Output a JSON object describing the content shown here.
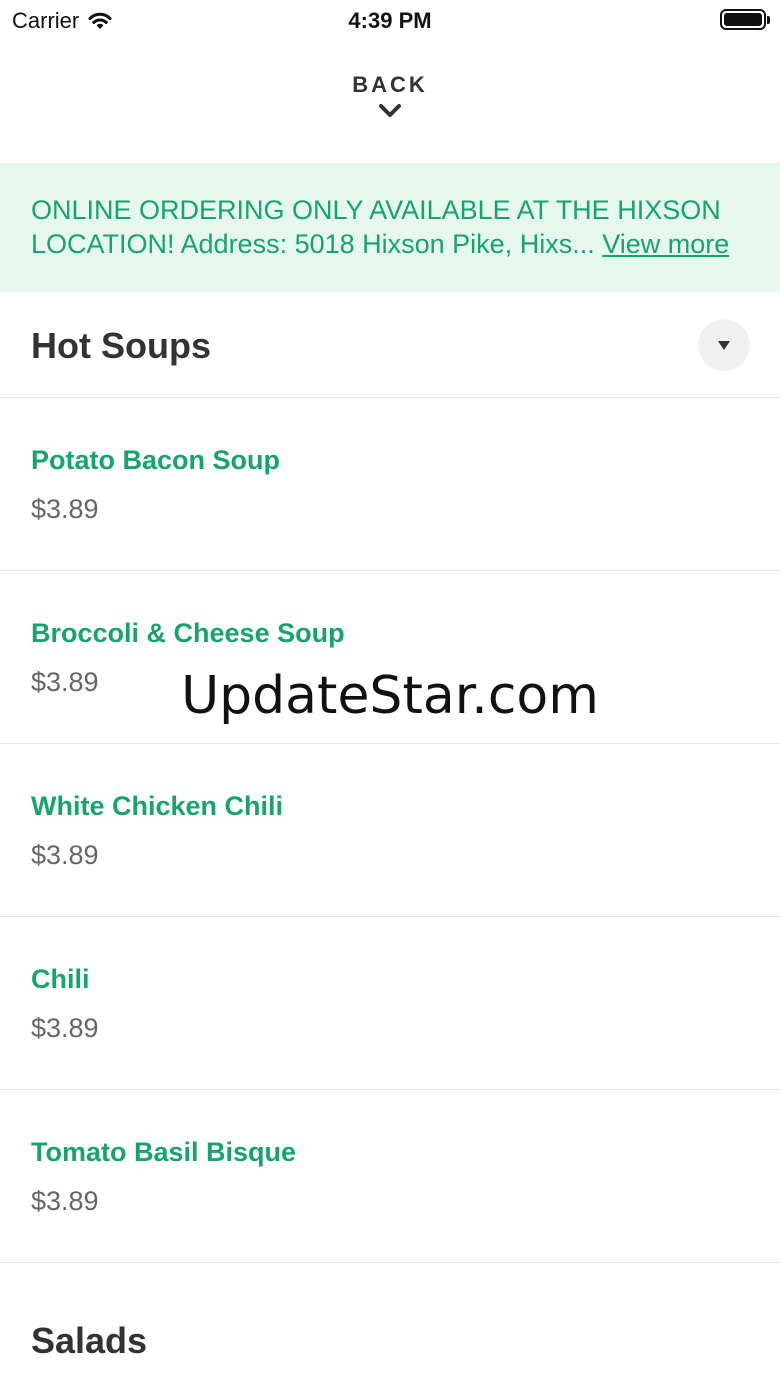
{
  "status_bar": {
    "carrier": "Carrier",
    "wifi_icon": "wifi-icon",
    "time": "4:39 PM",
    "battery_icon": "battery-icon"
  },
  "nav": {
    "back_label": "BACK",
    "chevron_icon": "chevron-down-icon"
  },
  "banner": {
    "text": "ONLINE ORDERING ONLY AVAILABLE AT THE HIXSON LOCATION! Address: 5018 Hixson Pike, Hixs...",
    "more_link": "View more",
    "color": "#17a46c",
    "background": "#e6f7ee"
  },
  "sections": [
    {
      "title": "Hot Soups",
      "toggle_icon": "caret-down-icon",
      "items": [
        {
          "name": "Potato Bacon Soup",
          "price": "$3.89"
        },
        {
          "name": "Broccoli & Cheese Soup",
          "price": "$3.89"
        },
        {
          "name": "White Chicken Chili",
          "price": "$3.89"
        },
        {
          "name": "Chili",
          "price": "$3.89"
        },
        {
          "name": "Tomato Basil Bisque",
          "price": "$3.89"
        }
      ]
    },
    {
      "title": "Salads"
    }
  ],
  "watermark": "UpdateStar.com",
  "colors": {
    "accent": "#17a46c",
    "text": "#333333",
    "price": "#666666",
    "divider": "#e6e6e6"
  }
}
